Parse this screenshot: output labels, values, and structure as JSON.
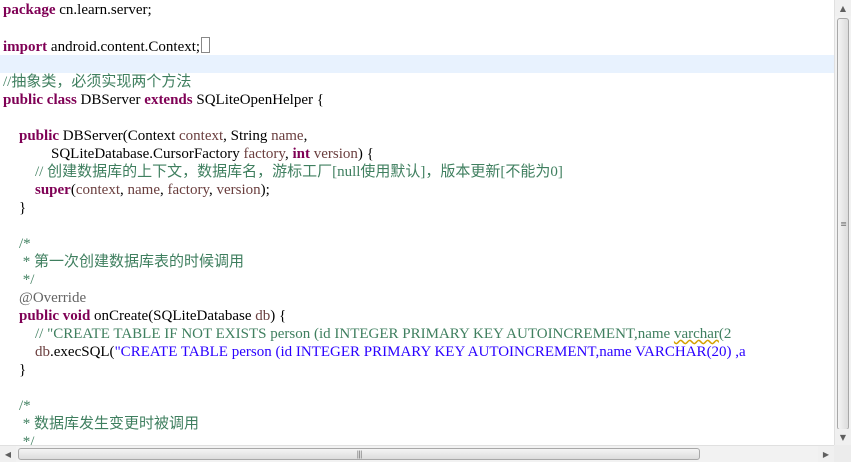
{
  "editor": {
    "line_package": {
      "kw": "package",
      "text": " cn.learn.server;"
    },
    "line_import": {
      "kw": "import",
      "text": " android.content.Context;"
    },
    "line_comment_abstract": "//抽象类，必须实现两个方法",
    "line_class": {
      "kw1": "public",
      "kw2": "class",
      "name": " DBServer ",
      "kw3": "extends",
      "rest": " SQLiteOpenHelper {"
    },
    "line_ctor": {
      "kw": "public",
      "t1": " DBServer(Context ",
      "p1": "context",
      "t2": ", String ",
      "p2": "name",
      "t3": ","
    },
    "line_ctor2": {
      "t1": "SQLiteDatabase.CursorFactory ",
      "p1": "factory",
      "t2": ", ",
      "kw": "int",
      "t3": " ",
      "p2": "version",
      "t4": ") {"
    },
    "line_ctor_comment": "// 创建数据库的上下文，数据库名，游标工厂[null使用默认]，版本更新[不能为0]",
    "line_super": {
      "kw": "super",
      "t1": "(",
      "p1": "context",
      "t2": ", ",
      "p2": "name",
      "t3": ", ",
      "p3": "factory",
      "t4": ", ",
      "p4": "version",
      "t5": ");"
    },
    "line_close1": "}",
    "line_doc1_open": "/*",
    "line_doc1_text": " * 第一次创建数据库表的时候调用",
    "line_doc1_close": " */",
    "line_override": "@Override",
    "line_oncreate": {
      "kw1": "public",
      "kw2": "void",
      "t1": " onCreate(SQLiteDatabase ",
      "p1": "db",
      "t2": ") {"
    },
    "line_oncreate_comment": {
      "text": "// \"CREATE TABLE IF NOT EXISTS person (id INTEGER PRIMARY KEY AUTOINCREMENT,name ",
      "squiggle": "varchar",
      "tail": "(2"
    },
    "line_exec": {
      "p1": "db",
      "t1": ".execSQL(",
      "str": "\"CREATE TABLE person (id INTEGER PRIMARY KEY AUTOINCREMENT,name VARCHAR(20) ,a"
    },
    "line_close2": "}",
    "line_doc2_open": "/*",
    "line_doc2_text": " * 数据库发生变更时被调用",
    "line_doc2_close": " */"
  },
  "colors": {
    "keyword": "#7f0055",
    "comment": "#3f7f5f",
    "param": "#6a3e3e",
    "string": "#2a00ff",
    "annotation": "#646464",
    "current_line": "#e8f2fe"
  },
  "icons": {
    "scroll_up": "arrow-up-icon",
    "scroll_down": "arrow-down-icon",
    "scroll_left": "arrow-left-icon",
    "scroll_right": "arrow-right-icon"
  }
}
